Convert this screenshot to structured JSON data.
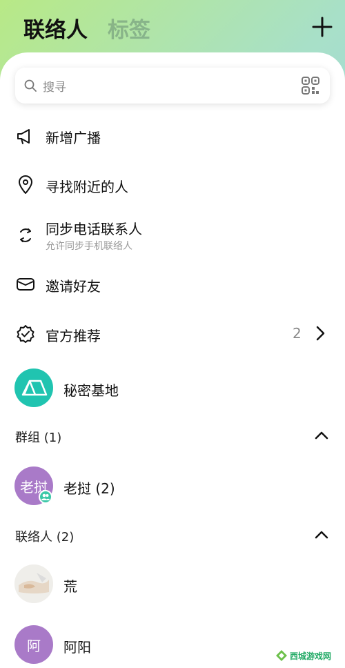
{
  "header": {
    "tab_contacts": "联络人",
    "tab_tags": "标签",
    "add_icon": "plus-icon"
  },
  "search": {
    "placeholder": "搜寻",
    "qr_icon": "qr-scan-icon"
  },
  "menu": {
    "broadcast": "新增广播",
    "nearby": "寻找附近的人",
    "sync": "同步电话联系人",
    "sync_sub": "允许同步手机联络人",
    "invite": "邀请好友",
    "official": "官方推荐",
    "official_count": "2"
  },
  "secret_base": {
    "label": "秘密基地",
    "color": "#20c4b0"
  },
  "groups": {
    "header": "群组 (1)",
    "items": [
      {
        "avatar_text": "老挝",
        "label": "老挝 (2)",
        "color": "#a97ac8"
      }
    ]
  },
  "contacts": {
    "header": "联络人 (2)",
    "items": [
      {
        "label": "荒"
      },
      {
        "avatar_text": "阿",
        "label": "阿阳",
        "color": "#a97ac8"
      }
    ]
  },
  "watermark": {
    "text": "西城游戏网"
  }
}
